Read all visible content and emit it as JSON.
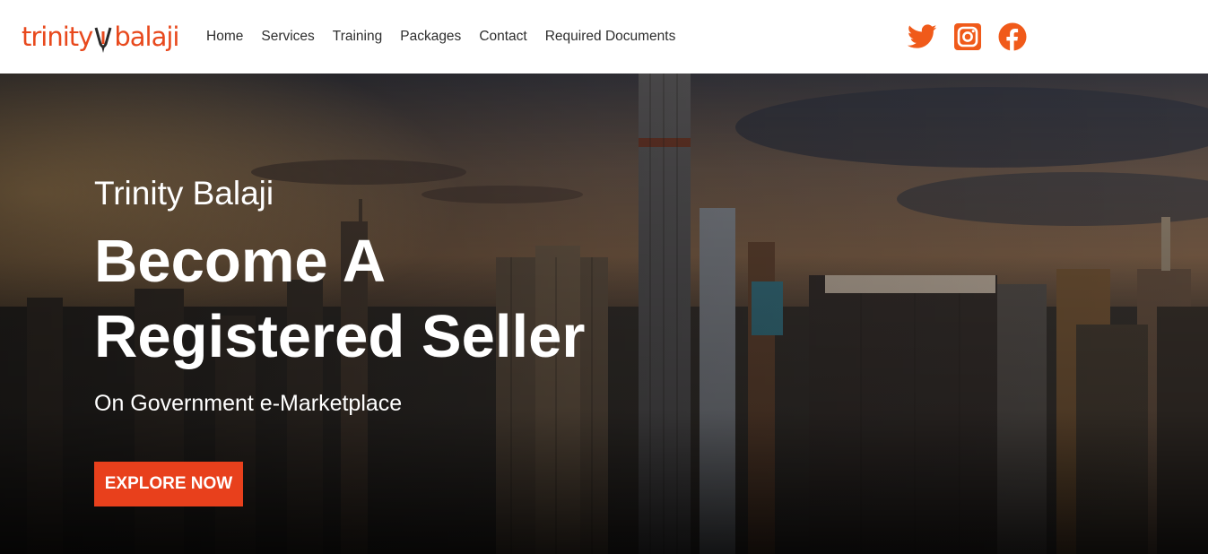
{
  "header": {
    "logo": {
      "left": "trinity",
      "right": "balaji"
    },
    "nav": [
      {
        "label": "Home"
      },
      {
        "label": "Services"
      },
      {
        "label": "Training"
      },
      {
        "label": "Packages"
      },
      {
        "label": "Contact"
      },
      {
        "label": "Required Documents"
      }
    ],
    "socials": [
      {
        "icon": "twitter-icon"
      },
      {
        "icon": "instagram-icon"
      },
      {
        "icon": "facebook-icon"
      }
    ],
    "brand_color": "#e8491d"
  },
  "hero": {
    "kicker": "Trinity Balaji",
    "title_line1": "Become A",
    "title_line2": "Registered Seller",
    "subtitle": "On Government e-Marketplace",
    "cta_label": "EXPLORE NOW",
    "cta_color": "#e8401c"
  }
}
